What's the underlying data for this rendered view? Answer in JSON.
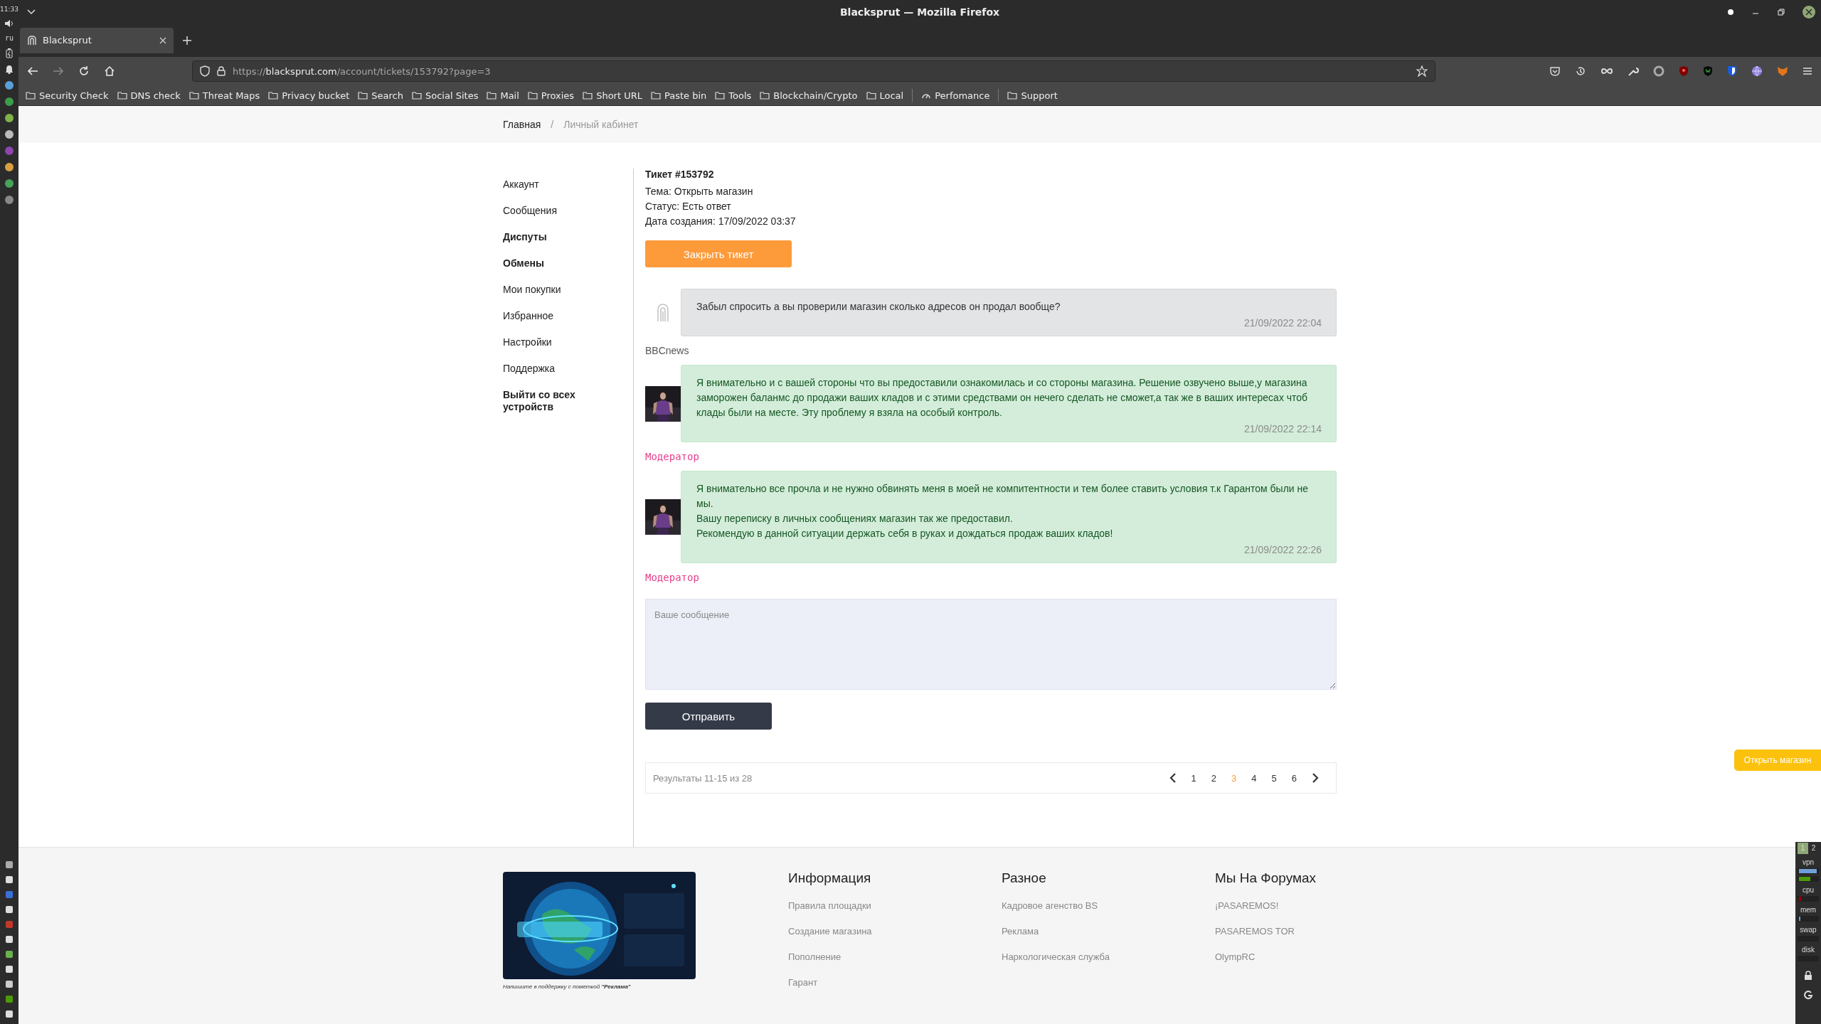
{
  "system_dock": {
    "time": "11:33",
    "keyboard_layout": "ru"
  },
  "window": {
    "title": "Blacksprut — Mozilla Firefox"
  },
  "tabs": [
    {
      "label": "Blacksprut",
      "selected": true
    }
  ],
  "address_bar": {
    "scheme": "https://",
    "domain": "blacksprut.com",
    "path": "/account/tickets/153792?page=3"
  },
  "bookmarks": [
    {
      "label": "Security Check",
      "kind": "folder"
    },
    {
      "label": "DNS check",
      "kind": "folder"
    },
    {
      "label": "Threat Maps",
      "kind": "folder"
    },
    {
      "label": "Privacy bucket",
      "kind": "folder"
    },
    {
      "label": "Search",
      "kind": "folder"
    },
    {
      "label": "Social Sites",
      "kind": "folder"
    },
    {
      "label": "Mail",
      "kind": "folder"
    },
    {
      "label": "Proxies",
      "kind": "folder"
    },
    {
      "label": "Short URL",
      "kind": "folder"
    },
    {
      "label": "Paste bin",
      "kind": "folder"
    },
    {
      "label": "Tools",
      "kind": "folder"
    },
    {
      "label": "Blockchain/Crypto",
      "kind": "folder"
    },
    {
      "label": "Local",
      "kind": "folder"
    },
    {
      "label": "Perfomance",
      "kind": "gauge"
    },
    {
      "label": "Support",
      "kind": "folder"
    }
  ],
  "breadcrumb": {
    "separator": "/",
    "items": [
      {
        "label": "Главная",
        "current": false
      },
      {
        "label": "Личный кабинет",
        "current": true
      }
    ]
  },
  "sidebar": {
    "items": [
      {
        "label": "Аккаунт",
        "bold": false
      },
      {
        "label": "Сообщения",
        "bold": false
      },
      {
        "label": "Диспуты",
        "bold": true
      },
      {
        "label": "Обмены",
        "bold": true
      },
      {
        "label": "Мои покупки",
        "bold": false
      },
      {
        "label": "Избранное",
        "bold": false
      },
      {
        "label": "Настройки",
        "bold": false
      },
      {
        "label": "Поддержка",
        "bold": false
      },
      {
        "label": "Выйти со всех устройств",
        "bold": true
      }
    ]
  },
  "ticket": {
    "title": "Тикет #153792",
    "subject": "Тема: Открыть магазин",
    "status": "Статус: Есть ответ",
    "created": "Дата создания: 17/09/2022 03:37",
    "close_button": "Закрыть тикет"
  },
  "messages": [
    {
      "kind": "user",
      "lines": [
        "Забыл спросить а вы проверили магазин сколько адресов он продал вообще?"
      ],
      "time": "21/09/2022 22:04",
      "author": "BBCnews"
    },
    {
      "kind": "moderator",
      "lines": [
        "Я внимательно и с вашей стороны что вы предоставили ознакомилась и со стороны магазина. Решение озвучено выше,у магазина заморожен баланмс до продажи ваших кладов и с этими средствами он нечего сделать не сможет,а так же в ваших интересах чтоб клады были на месте. Эту проблему я взяла на особый контроль."
      ],
      "time": "21/09/2022 22:14",
      "author": "Модератор"
    },
    {
      "kind": "moderator",
      "lines": [
        "Я внимательно все прочла и не нужно обвинять меня в моей не компитентности и тем более ставить условия т.к Гарантом были не мы.",
        "Вашу переписку в личных сообщениях магазин так же предоставил.",
        "Рекомендую в данной ситуации держать себя в руках и дождаться продаж ваших кладов!"
      ],
      "time": "21/09/2022 22:26",
      "author": "Модератор"
    }
  ],
  "reply_form": {
    "placeholder": "Ваше сообщение",
    "submit": "Отправить"
  },
  "pagination": {
    "summary": "Результаты 11-15 из 28",
    "pages": [
      {
        "label": "1",
        "selected": false
      },
      {
        "label": "2",
        "selected": false
      },
      {
        "label": "3",
        "selected": true
      },
      {
        "label": "4",
        "selected": false
      },
      {
        "label": "5",
        "selected": false
      },
      {
        "label": "6",
        "selected": false
      }
    ]
  },
  "floating_button": "Открыть магазин",
  "footer": {
    "banner": {
      "kind": "picture",
      "caption": "Напишите в поддержку с пометкой **\"Реклама\"**"
    },
    "columns": [
      {
        "title": "Информация",
        "links": [
          "Правила площадки",
          "Создание магазина",
          "Пополнение",
          "Гарант"
        ]
      },
      {
        "title": "Разное",
        "links": [
          "Кадровое агенство BS",
          "Реклама",
          "Наркологическая служба"
        ]
      },
      {
        "title": "Мы На Форумах",
        "links": [
          "¡PASAREMOS!",
          "PASAREMOS TOR",
          "OlympRC"
        ]
      }
    ]
  },
  "panel": {
    "workspaces": [
      {
        "label": "1",
        "selected": true
      },
      {
        "label": "2",
        "selected": false
      }
    ],
    "meters": [
      {
        "label": "vpn",
        "bars": [
          {
            "level": 0.95,
            "color": "#6f9fd8"
          },
          {
            "level": 0.6,
            "color": "#4e9a06"
          }
        ]
      },
      {
        "label": "cpu",
        "bars": [
          {
            "level": 0.12,
            "color": "#a40000"
          }
        ]
      },
      {
        "label": "mem",
        "bars": [
          {
            "level": 0.06,
            "color": "#6f9fd8"
          }
        ]
      },
      {
        "label": "swap"
      },
      {
        "label": "disk"
      }
    ]
  }
}
